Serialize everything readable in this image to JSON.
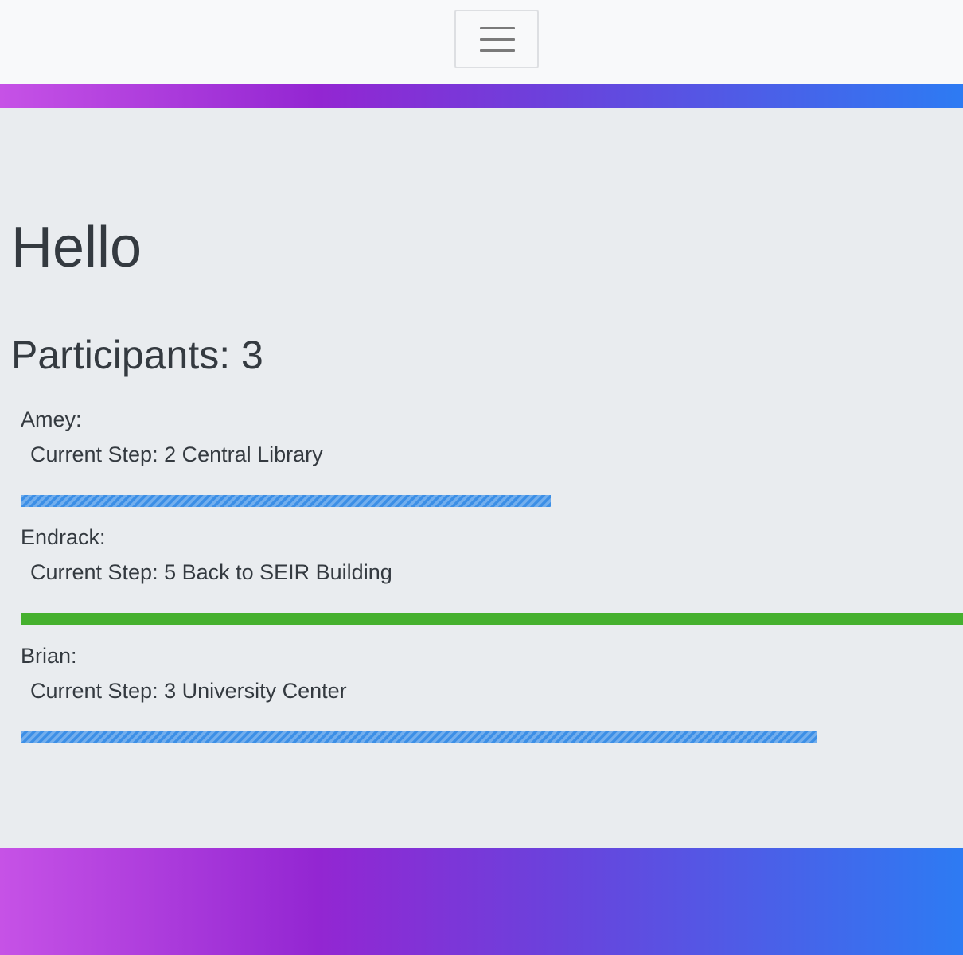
{
  "navbar": {
    "toggler_icon": "hamburger-menu-icon"
  },
  "colors": {
    "gradient_start": "#c652e6",
    "gradient_mid": "#9326d2",
    "gradient_end": "#2d7bf3",
    "progress_in_progress": "#3c8fe6",
    "progress_complete": "#45b02e"
  },
  "main": {
    "title": "Hello",
    "participants_label": "Participants: 3",
    "participants": [
      {
        "name": "Amey:",
        "step": "Current Step: 2 Central Library",
        "progress_fraction": 0.5625,
        "status": "in-progress"
      },
      {
        "name": "Endrack:",
        "step": "Current Step: 5 Back to SEIR Building",
        "progress_fraction": 1.0,
        "status": "complete"
      },
      {
        "name": "Brian:",
        "step": "Current Step: 3 University Center",
        "progress_fraction": 0.845,
        "status": "in-progress"
      }
    ]
  }
}
